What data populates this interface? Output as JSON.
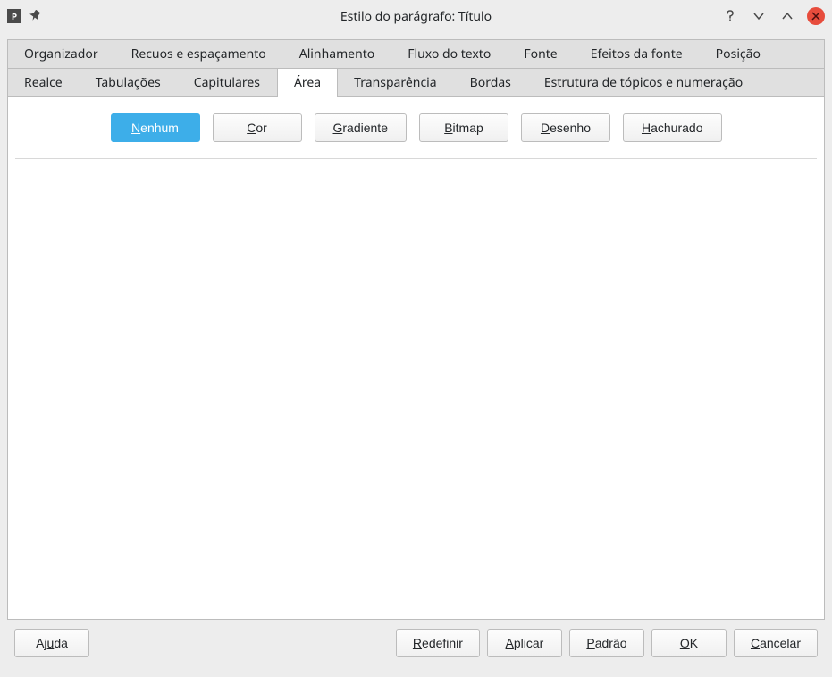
{
  "titlebar": {
    "title": "Estilo do parágrafo: Título"
  },
  "tabs": {
    "row1": [
      "Organizador",
      "Recuos e espaçamento",
      "Alinhamento",
      "Fluxo do texto",
      "Fonte",
      "Efeitos da fonte",
      "Posição"
    ],
    "row2": [
      "Realce",
      "Tabulações",
      "Capitulares",
      "Área",
      "Transparência",
      "Bordas",
      "Estrutura de tópicos e numeração"
    ],
    "active": "Área"
  },
  "fill_options": {
    "nenhum": {
      "pre": "N",
      "rest": "enhum"
    },
    "cor": {
      "pre": "C",
      "rest": "or"
    },
    "gradiente": {
      "pre": "G",
      "rest": "radiente"
    },
    "bitmap": {
      "pre": "B",
      "rest": "itmap"
    },
    "desenho": {
      "pre": "D",
      "rest": "esenho"
    },
    "hachurado": {
      "pre": "H",
      "rest": "achurado"
    },
    "selected": "nenhum"
  },
  "footer": {
    "ajuda": {
      "before": "Aj",
      "mn": "u",
      "after": "da"
    },
    "redefinir": {
      "before": "",
      "mn": "R",
      "after": "edefinir"
    },
    "aplicar": {
      "before": "",
      "mn": "A",
      "after": "plicar"
    },
    "padrao": {
      "before": "",
      "mn": "P",
      "after": "adrão"
    },
    "ok": {
      "before": "",
      "mn": "O",
      "after": "K"
    },
    "cancelar": {
      "before": "",
      "mn": "C",
      "after": "ancelar"
    }
  }
}
